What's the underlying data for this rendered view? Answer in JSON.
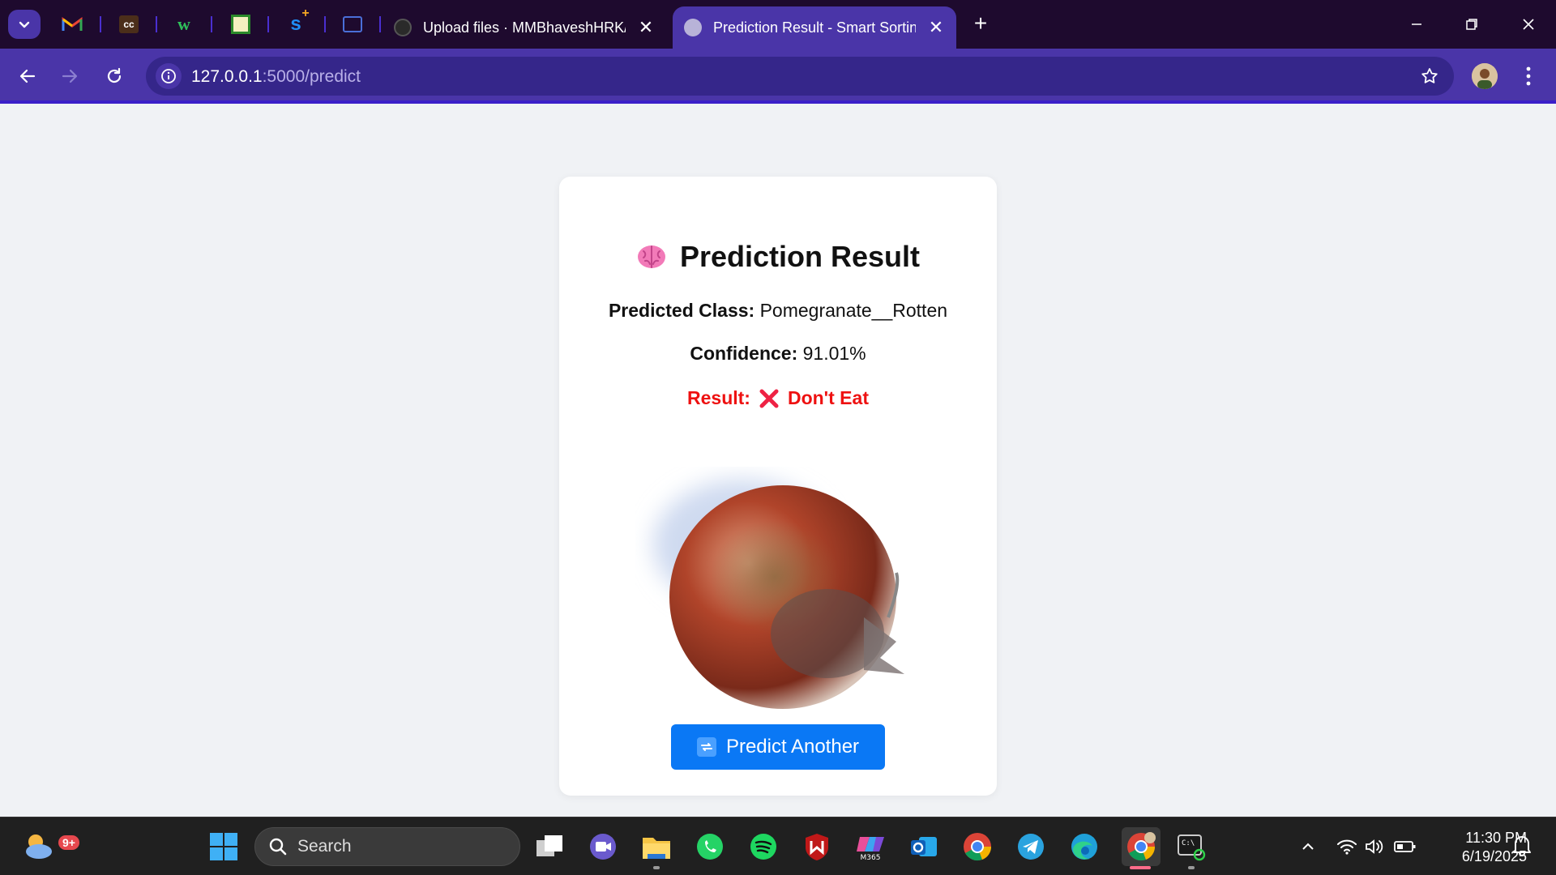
{
  "browser": {
    "tabs": [
      {
        "title": "Upload files · MMBhaveshHRK/",
        "active": false
      },
      {
        "title": "Prediction Result - Smart Sortin",
        "active": true
      }
    ],
    "url_host": "127.0.0.1",
    "url_path": ":5000/predict",
    "accent_color": "#4a35a8",
    "frame_color": "#1e0a2e"
  },
  "page": {
    "title": "Prediction Result",
    "predicted_class_label": "Predicted Class:",
    "predicted_class_value": "Pomegranate__Rotten",
    "confidence_label": "Confidence:",
    "confidence_value": "91.01%",
    "result_label": "Result:",
    "result_value": "Don't Eat",
    "result_color": "#ee1111",
    "button_label": "Predict Another",
    "button_color": "#0a78f5"
  },
  "taskbar": {
    "search_placeholder": "Search",
    "weather_badge": "9+",
    "time": "11:30 PM",
    "date": "6/19/2025"
  }
}
